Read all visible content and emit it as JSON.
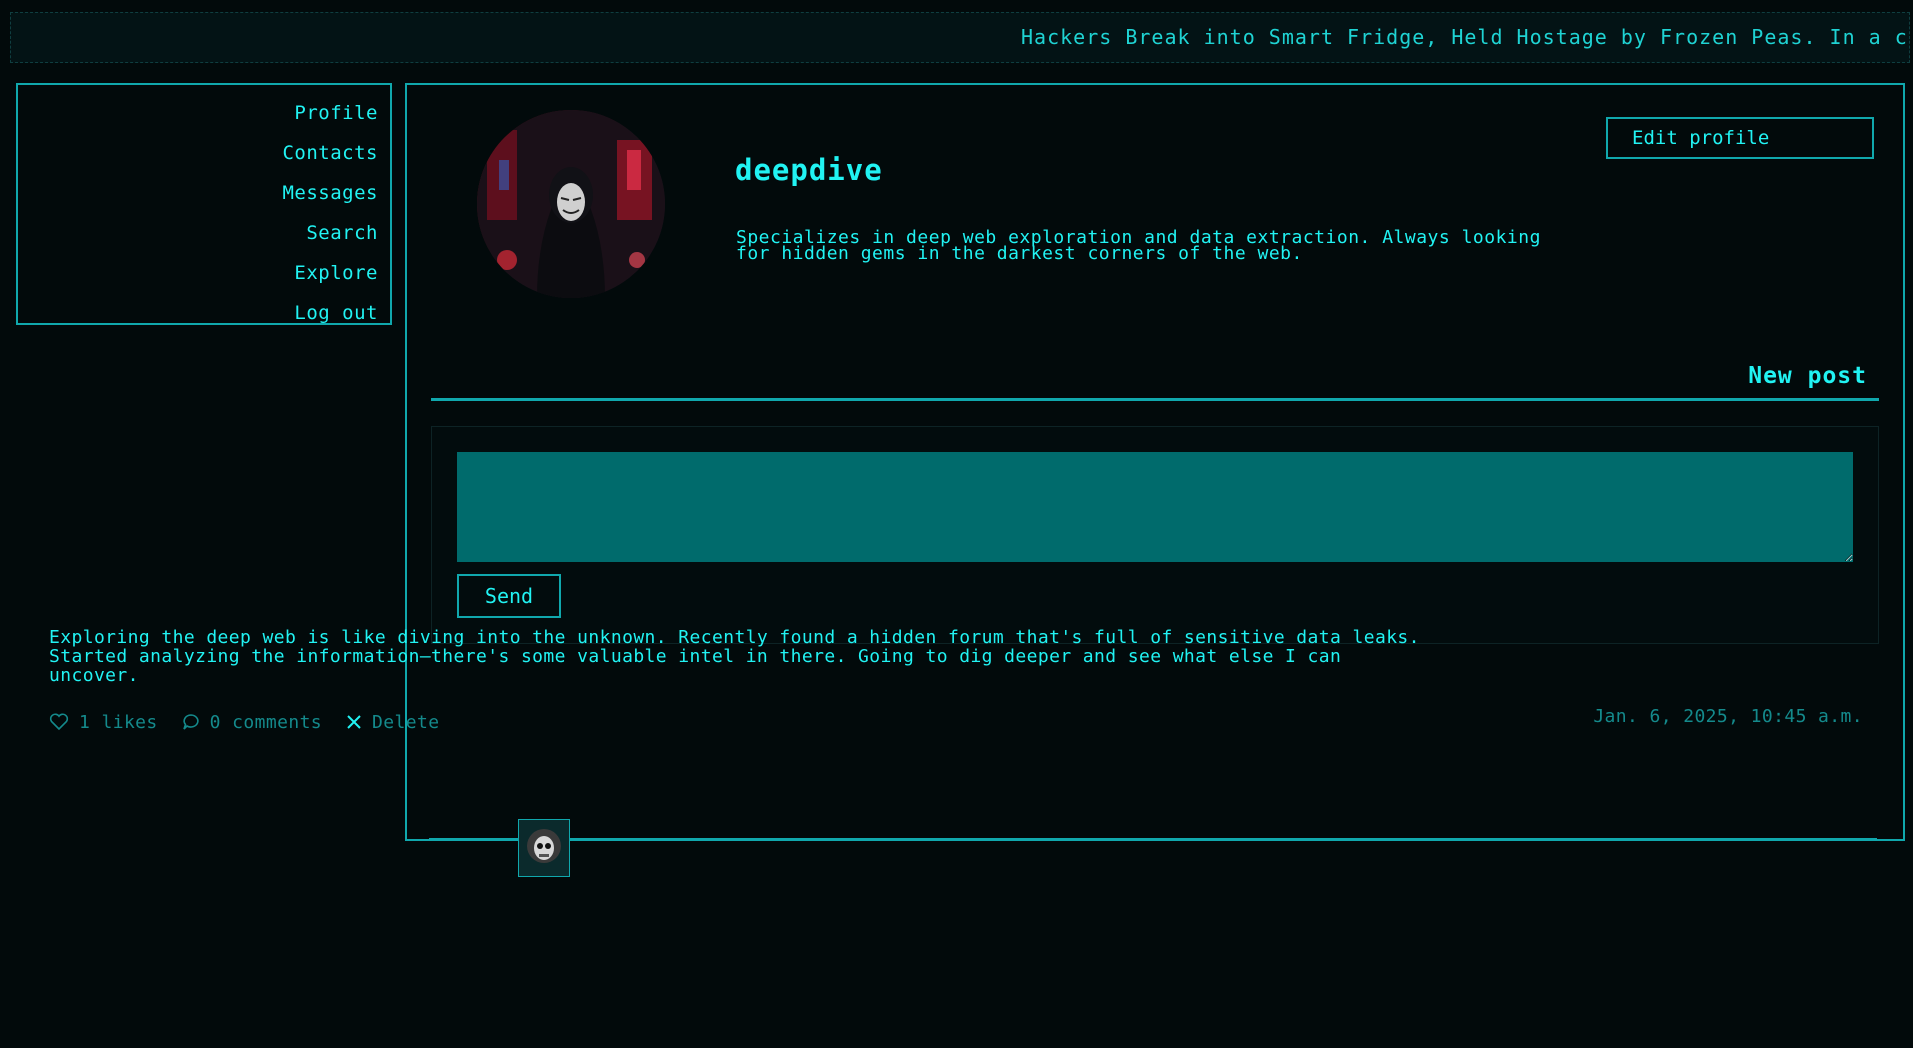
{
  "ticker": {
    "text": "Hackers Break into Smart Fridge, Held Hostage by Frozen Peas. In a ch"
  },
  "sidebar": {
    "items": [
      {
        "label": "Profile"
      },
      {
        "label": "Contacts"
      },
      {
        "label": "Messages"
      },
      {
        "label": "Search"
      },
      {
        "label": "Explore"
      },
      {
        "label": "Log out"
      }
    ]
  },
  "profile": {
    "username": "deepdive",
    "bio_line1": "Specializes in deep web exploration and data extraction. Always looking",
    "bio_line2": "for hidden gems in the darkest corners of the web.",
    "edit_label": "Edit profile"
  },
  "new_post": {
    "title": "New post",
    "textarea_value": "",
    "send_label": "Send"
  },
  "post": {
    "text_line1": "Exploring the deep web is like diving into the unknown. Recently found a hidden forum that's full of sensitive data leaks.",
    "text_line2": "Started analyzing the information—there's some valuable intel in there. Going to dig deeper and see what else I can",
    "text_line3": "uncover.",
    "likes": "1 likes",
    "comments": "0 comments",
    "delete_label": "Delete",
    "date": "Jan. 6, 2025, 10:45 a.m."
  },
  "colors": {
    "accent": "#21f3f3",
    "border": "#10a8ad",
    "muted": "#148a8c",
    "background": "#020a0b",
    "input": "#006b6c"
  }
}
